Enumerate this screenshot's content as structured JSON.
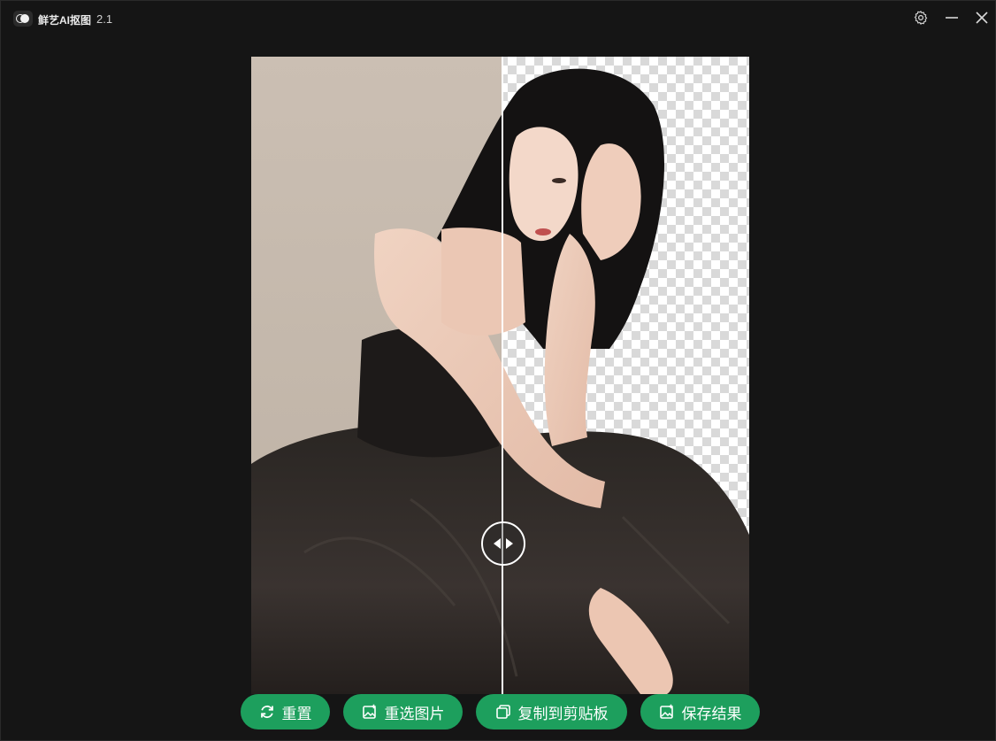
{
  "app": {
    "name": "鲜艺AI抠图",
    "version": "2.1"
  },
  "window_controls": {
    "settings_icon": "gear-icon",
    "minimize_icon": "minimize-icon",
    "close_icon": "close-icon"
  },
  "viewer": {
    "compare_handle_icon": "left-right-arrows-icon",
    "left_side": "original photo",
    "right_side": "background removed (transparent checkerboard)",
    "split_position": 0.5
  },
  "actions": {
    "reset_label": "重置",
    "reselect_label": "重选图片",
    "copy_label": "复制到剪贴板",
    "save_label": "保存结果"
  },
  "colors": {
    "button_bg": "#1d9f5d",
    "window_bg": "#151515",
    "divider": "#ffffff"
  }
}
